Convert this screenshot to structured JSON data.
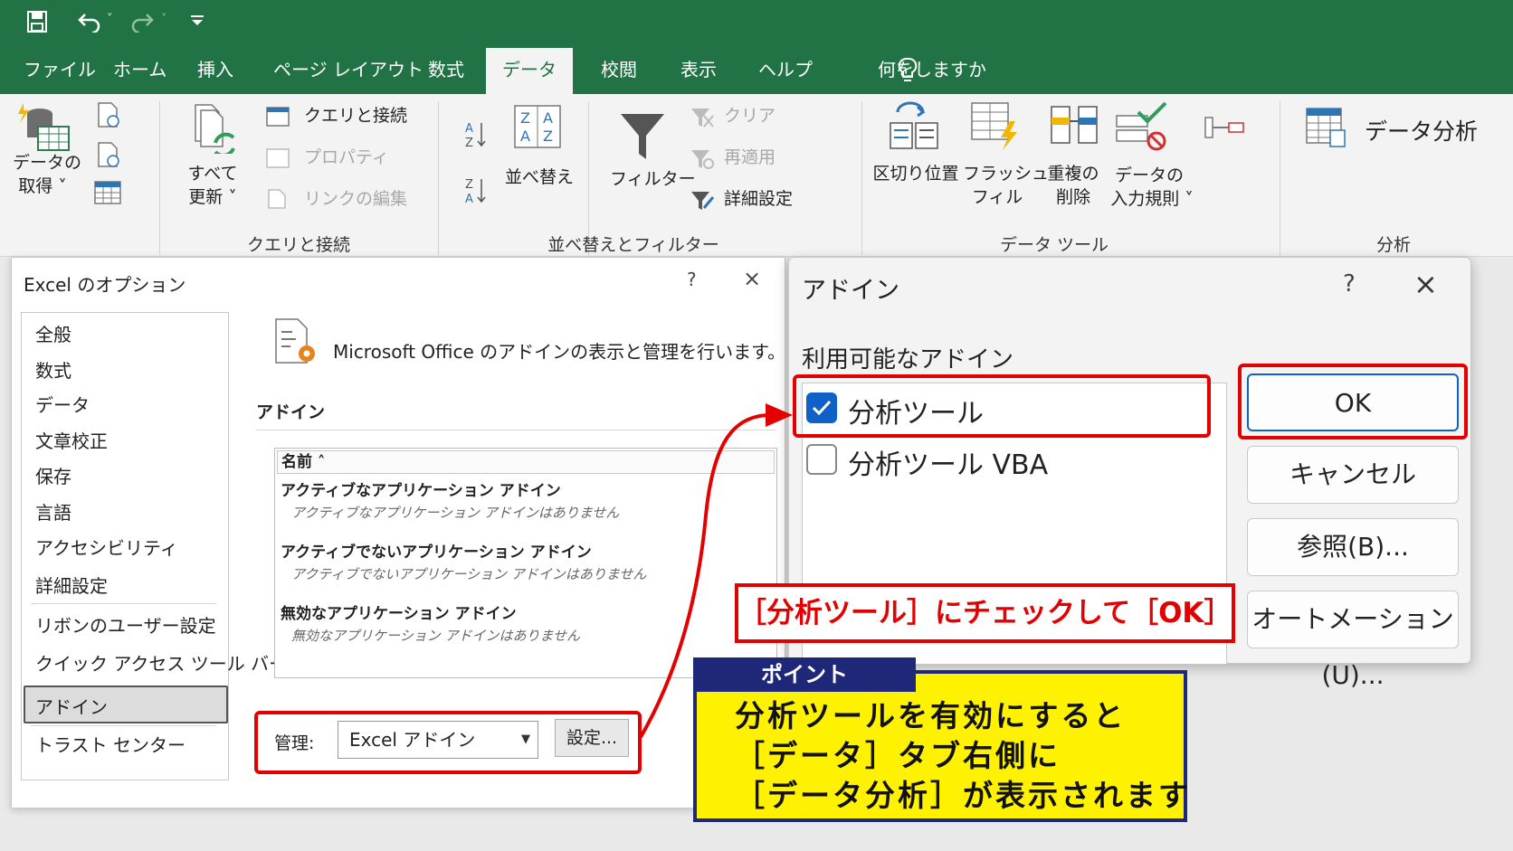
{
  "colors": {
    "excel_green": "#217346",
    "ribbon_bg": "#f3f3f3",
    "highlight_red": "#e30000",
    "point_navy": "#1f2878",
    "point_yellow": "#fff200",
    "check_blue": "#0f61c7"
  },
  "quick_access": {
    "icons": [
      "save-icon",
      "undo-icon",
      "redo-icon",
      "customize-icon"
    ]
  },
  "tabs": [
    {
      "label": "ファイル"
    },
    {
      "label": "ホーム"
    },
    {
      "label": "挿入"
    },
    {
      "label": "ページ レイアウト"
    },
    {
      "label": "数式"
    },
    {
      "label": "データ"
    },
    {
      "label": "校閲"
    },
    {
      "label": "表示"
    },
    {
      "label": "ヘルプ"
    }
  ],
  "active_tab": "データ",
  "tell_me": {
    "placeholder": "何をしますか",
    "icon": "lightbulb-icon"
  },
  "ribbon": {
    "get_data": {
      "label_line1": "データの",
      "label_line2": "取得 ˅"
    },
    "refresh_all": {
      "label_line1": "すべて",
      "label_line2": "更新 ˅"
    },
    "queries": [
      "クエリと接続",
      "プロパティ",
      "リンクの編集"
    ],
    "queries_group": "クエリと接続",
    "sort_label": "並べ替え",
    "filter_label": "フィルター",
    "filter_actions": [
      "クリア",
      "再適用",
      "詳細設定"
    ],
    "sort_group": "並べ替えとフィルター",
    "tools": [
      {
        "line1": "区切り位置",
        "line2": ""
      },
      {
        "line1": "フラッシュ",
        "line2": "フィル"
      },
      {
        "line1": "重複の",
        "line2": "削除"
      },
      {
        "line1": "データの",
        "line2": "入力規則 ˅"
      }
    ],
    "tools_group": "データ ツール",
    "analysis_label": "データ分析",
    "analysis_group": "分析"
  },
  "options_dialog": {
    "title": "Excel のオプション",
    "help": "?",
    "close": "×",
    "nav": [
      "全般",
      "数式",
      "データ",
      "文章校正",
      "保存",
      "言語",
      "アクセシビリティ",
      "詳細設定",
      "リボンのユーザー設定",
      "クイック アクセス ツール バー",
      "アドイン",
      "トラスト センター"
    ],
    "selected_nav": "アドイン",
    "description": "Microsoft Office のアドインの表示と管理を行います。",
    "section": "アドイン",
    "column_header": "名前 ˄",
    "categories": [
      {
        "title": "アクティブなアプリケーション アドイン",
        "empty": "アクティブなアプリケーション アドインはありません"
      },
      {
        "title": "アクティブでないアプリケーション アドイン",
        "empty": "アクティブでないアプリケーション アドインはありません"
      },
      {
        "title": "無効なアプリケーション アドイン",
        "empty": "無効なアプリケーション アドインはありません"
      }
    ],
    "manage_label": "管理:",
    "manage_value": "Excel アドイン",
    "go_button": "設定..."
  },
  "addins_dialog": {
    "title": "アドイン",
    "help": "?",
    "close": "×",
    "subtitle": "利用可能なアドイン",
    "items": [
      {
        "label": "分析ツール",
        "checked": true
      },
      {
        "label": "分析ツール VBA",
        "checked": false
      }
    ],
    "buttons": {
      "ok": "OK",
      "cancel": "キャンセル",
      "browse": "参照(B)...",
      "automation": "オートメーション(U)..."
    }
  },
  "callout": {
    "note": "［分析ツール］にチェックして［OK］",
    "point_tab": "ポイント",
    "point_lines": [
      "分析ツールを有効にすると",
      "［データ］タブ右側に",
      "［データ分析］が表示されます"
    ]
  }
}
